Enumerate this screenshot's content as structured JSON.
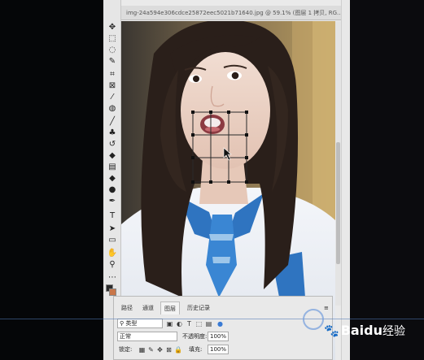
{
  "document": {
    "tab_title": "img-24a594e306cdce25872eec5021b71640.jpg @ 59.1% (图层 1 拷贝, RG..."
  },
  "toolbar": {
    "tools": [
      {
        "name": "move-tool-icon",
        "glyph": "✥"
      },
      {
        "name": "marquee-tool-icon",
        "glyph": "⬚"
      },
      {
        "name": "lasso-tool-icon",
        "glyph": "◌"
      },
      {
        "name": "quick-select-tool-icon",
        "glyph": "✎"
      },
      {
        "name": "crop-tool-icon",
        "glyph": "⌗"
      },
      {
        "name": "frame-tool-icon",
        "glyph": "⊠"
      },
      {
        "name": "eyedropper-tool-icon",
        "glyph": "⁄"
      },
      {
        "name": "healing-brush-tool-icon",
        "glyph": "◍"
      },
      {
        "name": "brush-tool-icon",
        "glyph": "╱"
      },
      {
        "name": "clone-stamp-tool-icon",
        "glyph": "♣"
      },
      {
        "name": "history-brush-tool-icon",
        "glyph": "↺"
      },
      {
        "name": "eraser-tool-icon",
        "glyph": "◆"
      },
      {
        "name": "gradient-tool-icon",
        "glyph": "▤"
      },
      {
        "name": "blur-tool-icon",
        "glyph": "◆"
      },
      {
        "name": "dodge-tool-icon",
        "glyph": "●"
      },
      {
        "name": "pen-tool-icon",
        "glyph": "✒"
      },
      {
        "name": "type-tool-icon",
        "glyph": "T"
      },
      {
        "name": "path-select-tool-icon",
        "glyph": "➤"
      },
      {
        "name": "rectangle-tool-icon",
        "glyph": "▭"
      },
      {
        "name": "hand-tool-icon",
        "glyph": "✋"
      },
      {
        "name": "zoom-tool-icon",
        "glyph": "⚲"
      },
      {
        "name": "more-tools-icon",
        "glyph": "⋯"
      }
    ],
    "foreground_color": "#2b2b2b",
    "background_color": "#c9774a"
  },
  "layers_panel": {
    "tabs": [
      "路径",
      "通道",
      "图层",
      "历史记录"
    ],
    "active_tab": "图层",
    "filter_label": "类型",
    "blend_mode": "正常",
    "opacity_label": "不透明度:",
    "opacity_value": "100%",
    "lock_label": "锁定:",
    "fill_label": "填充:",
    "fill_value": "100%"
  },
  "watermark": {
    "brand": "Baidu",
    "product": "经验"
  }
}
